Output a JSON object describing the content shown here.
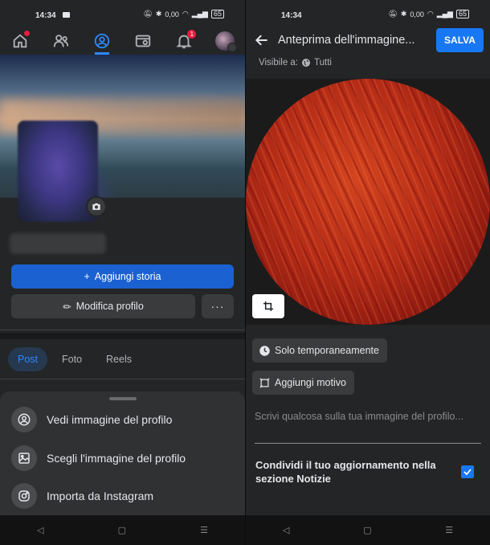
{
  "status_bar": {
    "time": "14:34",
    "battery": "65",
    "network": "0,00"
  },
  "left": {
    "nav": {
      "notifications_badge": "1"
    },
    "add_story_label": "Aggiungi storia",
    "edit_profile_label": "Modifica profilo",
    "more_label": "···",
    "tabs": [
      {
        "label": "Post",
        "active": true
      },
      {
        "label": "Foto",
        "active": false
      },
      {
        "label": "Reels",
        "active": false
      }
    ],
    "sheet": {
      "items": [
        {
          "label": "Vedi immagine del profilo",
          "icon": "user-circle-icon"
        },
        {
          "label": "Scegli l'immagine del profilo",
          "icon": "image-icon"
        },
        {
          "label": "Importa da Instagram",
          "icon": "instagram-icon"
        }
      ]
    }
  },
  "right": {
    "title": "Anteprima dell'immagine...",
    "save_label": "SALVA",
    "visibility_prefix": "Visibile a:",
    "visibility_value": "Tutti",
    "temporary_label": "Solo temporaneamente",
    "frame_label": "Aggiungi motivo",
    "caption_placeholder": "Scrivi qualcosa sulla tua immagine del profilo...",
    "share_label": "Condividi il tuo aggiornamento nella sezione Notizie",
    "share_checked": true
  },
  "system_nav": {
    "back": "◁",
    "home": "▢",
    "menu": "☰"
  },
  "colors": {
    "accent": "#1877f2",
    "primary_button": "#1b61d1",
    "background": "#242526"
  }
}
